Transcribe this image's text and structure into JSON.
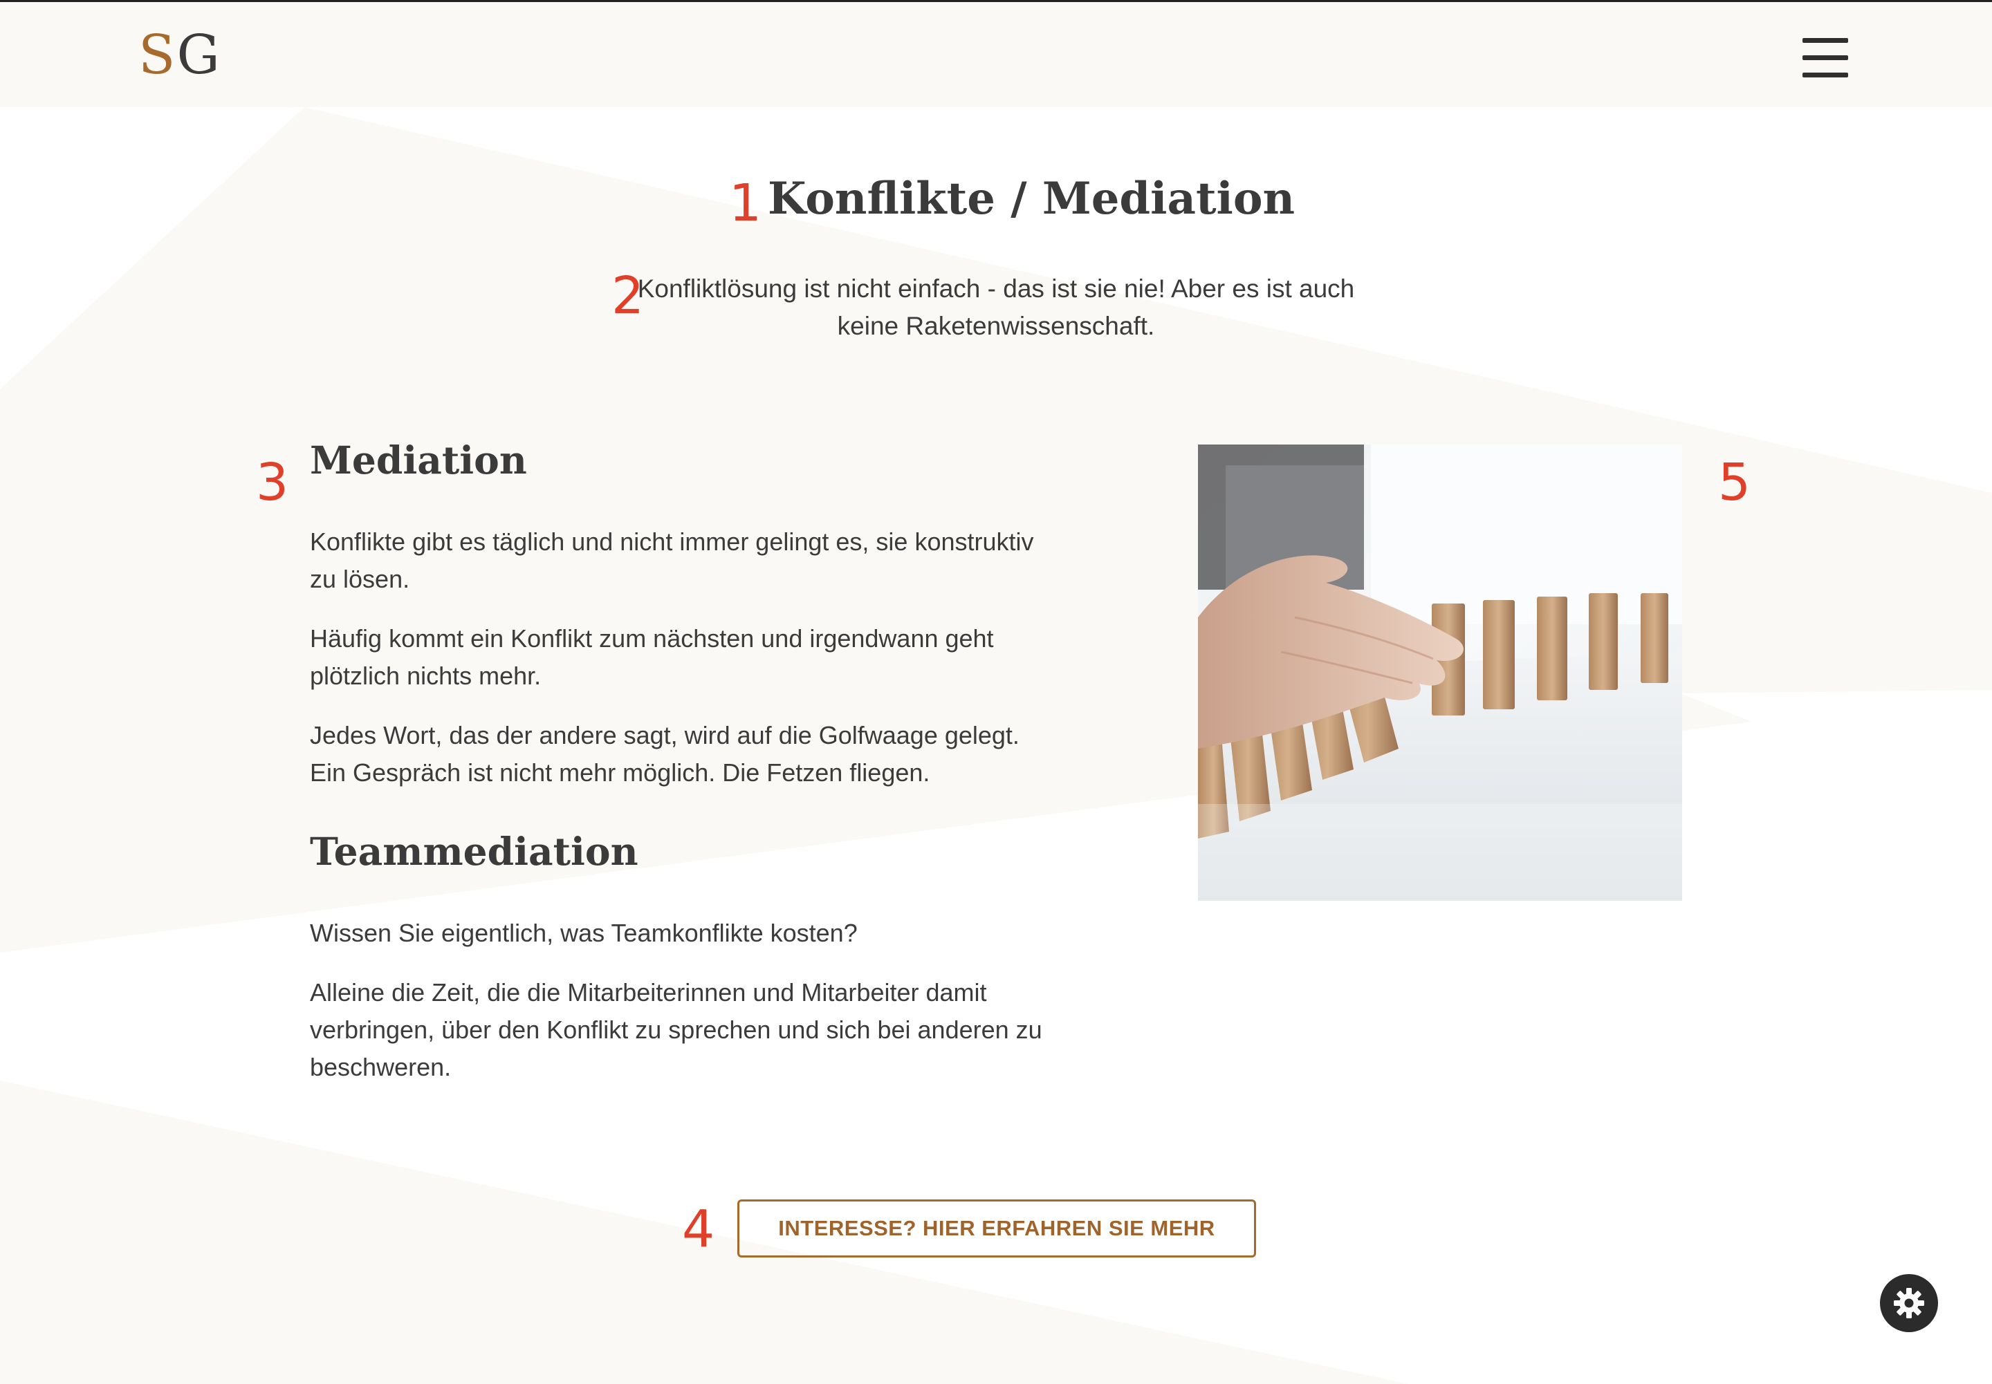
{
  "logo": {
    "letter_1": "S",
    "letter_2": "G"
  },
  "header": {
    "menu_icon": "hamburger-menu-icon"
  },
  "markers": [
    "1",
    "2",
    "3",
    "4",
    "5"
  ],
  "hero": {
    "title": "Konflikte / Mediation",
    "intro_line_1": "Konfliktlösung ist nicht einfach - das ist sie nie! Aber es ist auch",
    "intro_line_2": "keine Raketenwissenschaft."
  },
  "sections": {
    "mediation": {
      "heading": "Mediation",
      "paragraphs": [
        "Konflikte gibt es täglich und nicht immer gelingt es, sie konstruktiv zu lösen.",
        "Häufig kommt ein Konflikt zum nächsten und irgendwann geht plötzlich nichts mehr.",
        "Jedes Wort, das der andere sagt, wird auf die Golfwaage gelegt. Ein Gespräch ist nicht mehr möglich. Die Fetzen fliegen."
      ]
    },
    "teammediation": {
      "heading": "Teammediation",
      "paragraphs": [
        "Wissen Sie eigentlich, was Teamkonflikte kosten?",
        "Alleine die Zeit, die die Mitarbeiterinnen und Mitarbeiter damit verbringen, über den Konflikt zu sprechen und sich bei anderen zu beschweren."
      ]
    }
  },
  "image": {
    "icon": "domino-hand-photo"
  },
  "cta": {
    "label": "INTERESSE? HIER ERFAHREN SIE MEHR"
  },
  "settings": {
    "icon": "gear-icon"
  },
  "colors": {
    "accent": "#a86a2c",
    "marker": "#e0402a",
    "text": "#3b3b3b",
    "background": "#faf9f6"
  }
}
